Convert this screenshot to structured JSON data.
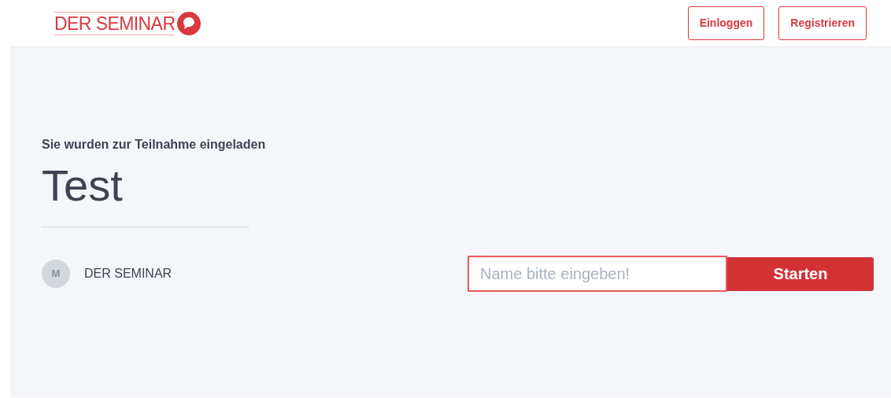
{
  "header": {
    "logo": "DER SEMINAR",
    "buttons": [
      "Einloggen",
      "Registrieren"
    ]
  },
  "invite": {
    "subtitle": "Sie wurden zur Teilnahme eingeladen",
    "title": "Test",
    "host": {
      "initial": "M",
      "name": "DER SEMINAR"
    },
    "name_field": {
      "placeholder": "Name bitte eingeben!"
    },
    "start_button": "Starten"
  }
}
